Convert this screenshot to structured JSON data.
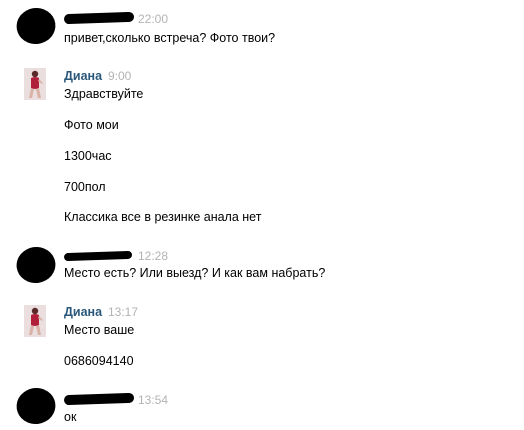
{
  "messages": [
    {
      "author": "",
      "time": "22:00",
      "lines": [
        "привет,сколько встреча? Фото твои?"
      ]
    },
    {
      "author": "Диана",
      "time": "9:00",
      "lines": [
        "Здравствуйте",
        "Фото мои",
        "1300час",
        "700пол",
        "Классика все в резинке анала нет"
      ]
    },
    {
      "author": "",
      "time": "12:28",
      "lines": [
        "Место есть? Или выезд? И как вам набрать?"
      ]
    },
    {
      "author": "Диана",
      "time": "13:17",
      "lines": [
        "Место ваше",
        "0686094140"
      ]
    },
    {
      "author": "",
      "time": "13:54",
      "lines": [
        "ок"
      ]
    }
  ],
  "colors": {
    "author": "#2b587a",
    "time": "#b3b3b3",
    "text": "#000000"
  }
}
